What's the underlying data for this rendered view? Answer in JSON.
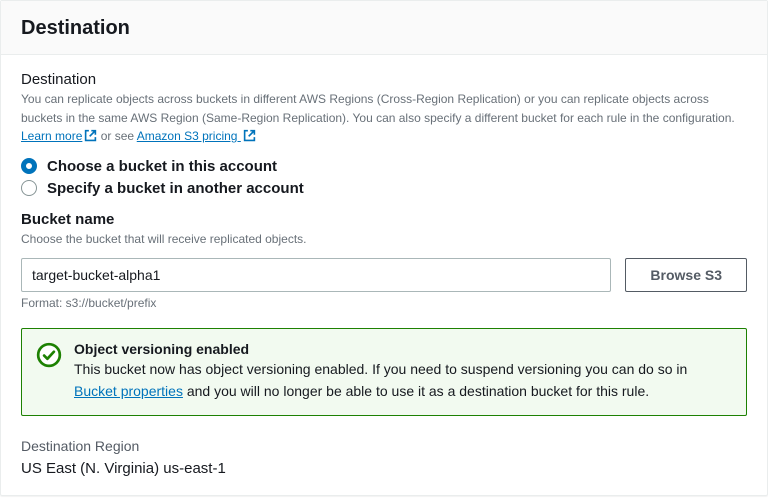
{
  "header": {
    "title": "Destination"
  },
  "destination": {
    "label": "Destination",
    "help_pre": "You can replicate objects across buckets in different AWS Regions (Cross-Region Replication) or you can replicate objects across buckets in the same AWS Region (Same-Region Replication). You can also specify a different bucket for each rule in the configuration. ",
    "learn_more_label": "Learn more",
    "help_mid": " or see ",
    "pricing_label": "Amazon S3 pricing",
    "radios": {
      "this_account": "Choose a bucket in this account",
      "other_account": "Specify a bucket in another account"
    }
  },
  "bucket": {
    "label": "Bucket name",
    "help": "Choose the bucket that will receive replicated objects.",
    "value": "target-bucket-alpha1",
    "browse_label": "Browse S3",
    "format_hint": "Format: s3://bucket/prefix"
  },
  "alert": {
    "title": "Object versioning enabled",
    "text_pre": "This bucket now has object versioning enabled. If you need to suspend versioning you can do so in ",
    "link_label": "Bucket properties",
    "text_post": " and you will no longer be able to use it as a destination bucket for this rule."
  },
  "region": {
    "label": "Destination Region",
    "value": "US East (N. Virginia) us-east-1"
  }
}
